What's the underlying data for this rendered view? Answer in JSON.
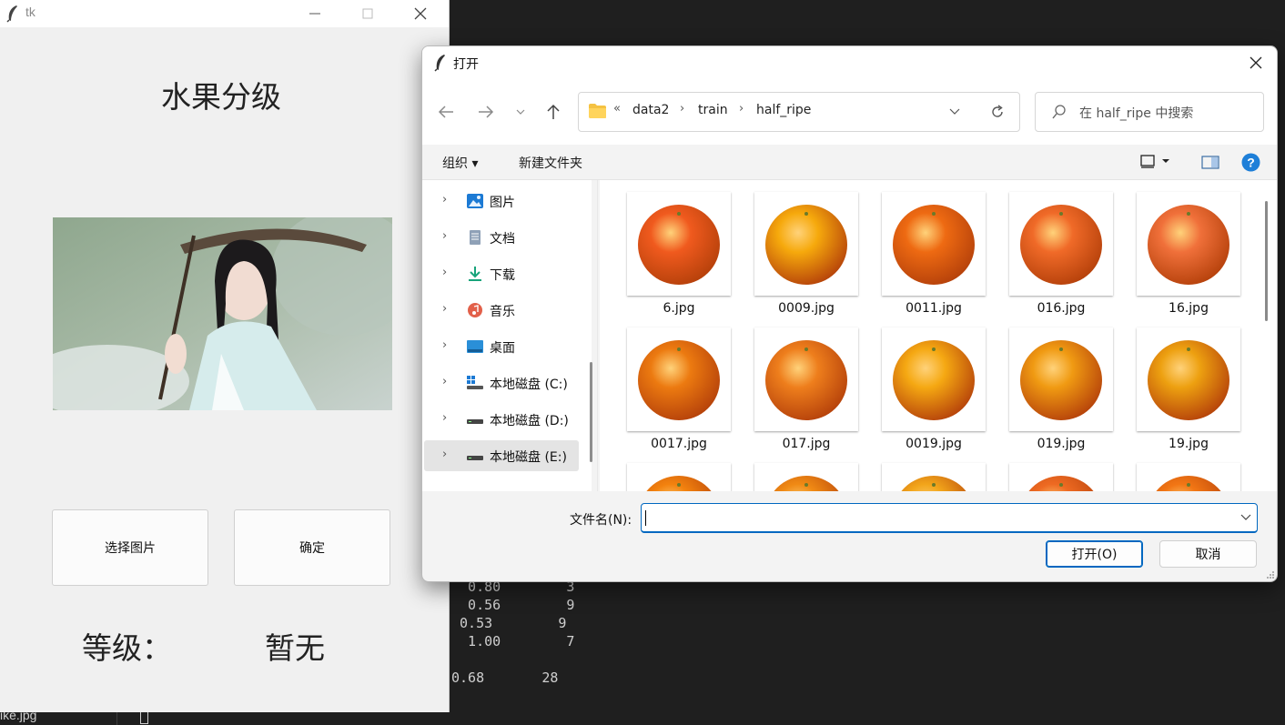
{
  "terminal": {
    "lines": [
      {
        "text": "  0.80        3"
      },
      {
        "text": "  0.56        9"
      },
      {
        "text": " 0.53        9"
      },
      {
        "text": "  1.00        7"
      },
      {
        "text": "0.68       28"
      }
    ],
    "taskbar_text": "ike.jpg"
  },
  "tk_window": {
    "title": "tk",
    "heading": "水果分级",
    "buttons": {
      "select": "选择图片",
      "confirm": "确定"
    },
    "grade_label": "等级：",
    "grade_value": "暂无"
  },
  "dialog": {
    "title": "打开",
    "breadcrumb": {
      "overflow": "«",
      "items": [
        "data2",
        "train",
        "half_ripe"
      ]
    },
    "search_placeholder": "在 half_ripe 中搜索",
    "toolbar": {
      "organize": "组织 ▾",
      "new_folder": "新建文件夹"
    },
    "nav_items": [
      {
        "label": "图片",
        "icon": "pictures-icon"
      },
      {
        "label": "文档",
        "icon": "documents-icon"
      },
      {
        "label": "下载",
        "icon": "downloads-icon"
      },
      {
        "label": "音乐",
        "icon": "music-icon"
      },
      {
        "label": "桌面",
        "icon": "desktop-icon"
      },
      {
        "label": "本地磁盘 (C:)",
        "icon": "drive-c-icon"
      },
      {
        "label": "本地磁盘 (D:)",
        "icon": "drive-icon"
      },
      {
        "label": "本地磁盘 (E:)",
        "icon": "drive-icon",
        "selected": true
      }
    ],
    "files": [
      {
        "name": "6.jpg",
        "color": "#f05a1e"
      },
      {
        "name": "0009.jpg",
        "color": "#f6a90c"
      },
      {
        "name": "0011.jpg",
        "color": "#ee6a12"
      },
      {
        "name": "016.jpg",
        "color": "#f06a28"
      },
      {
        "name": "16.jpg",
        "color": "#f0703a"
      },
      {
        "name": "0017.jpg",
        "color": "#ec7a10"
      },
      {
        "name": "017.jpg",
        "color": "#ee7e1c"
      },
      {
        "name": "0019.jpg",
        "color": "#f5a812"
      },
      {
        "name": "019.jpg",
        "color": "#f09a12"
      },
      {
        "name": "19.jpg",
        "color": "#eda010"
      },
      {
        "name": "",
        "color": "#f3820e"
      },
      {
        "name": "",
        "color": "#f08a14"
      },
      {
        "name": "",
        "color": "#f2a51a"
      },
      {
        "name": "",
        "color": "#ee6a22"
      },
      {
        "name": "",
        "color": "#f27614"
      }
    ],
    "filename_label": "文件名(N):",
    "filename_value": "",
    "open_button": "打开(O)",
    "cancel_button": "取消"
  }
}
